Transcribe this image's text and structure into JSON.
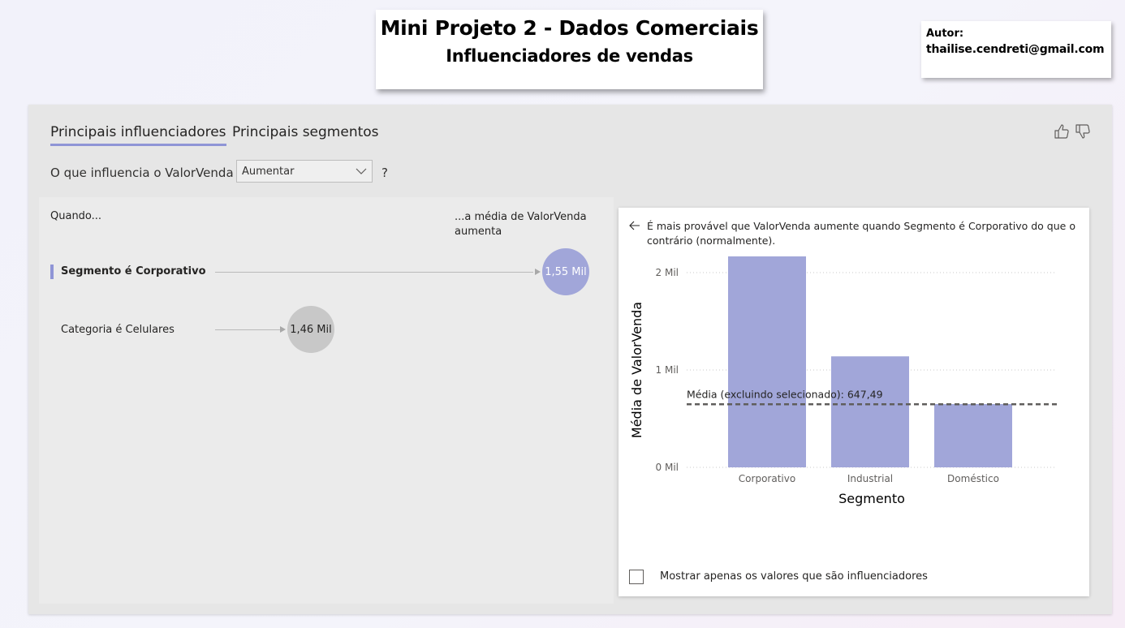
{
  "header": {
    "title": "Mini Projeto 2 - Dados Comerciais",
    "subtitle": "Influenciadores de vendas"
  },
  "author": {
    "label": "Autor:",
    "email": "thailise.cendreti@gmail.com"
  },
  "tabs": [
    {
      "label": "Principais influenciadores",
      "active": true
    },
    {
      "label": "Principais segmentos",
      "active": false
    }
  ],
  "feedback": {
    "like_icon": "thumbs-up-icon",
    "dislike_icon": "thumbs-down-icon"
  },
  "query": {
    "prefix": "O que influencia o ValorVenda a",
    "dropdown_value": "Aumentar",
    "help": "?"
  },
  "influencers": {
    "col_when": "Quando...",
    "col_avg": "...a média de ValorVenda aumenta",
    "rows": [
      {
        "label": "Segmento é Corporativo",
        "value_label": "1,55 Mil",
        "value": 1.55,
        "selected": true
      },
      {
        "label": "Categoria é Celulares",
        "value_label": "1,46 Mil",
        "value": 1.46,
        "selected": false
      }
    ]
  },
  "detail": {
    "back_icon": "back-arrow-icon",
    "description": "É mais provável que ValorVenda aumente quando Segmento é Corporativo do que o contrário (normalmente).",
    "checkbox_label": "Mostrar apenas os valores que são influenciadores",
    "checkbox_checked": false
  },
  "chart_data": {
    "type": "bar",
    "categories": [
      "Corporativo",
      "Industrial",
      "Doméstico"
    ],
    "values": [
      2.2,
      1.14,
      0.65
    ],
    "xlabel": "Segmento",
    "ylabel": "Média de ValorVenda",
    "ylim": [
      0,
      2
    ],
    "yticks": [
      0,
      1,
      2
    ],
    "ytick_labels": [
      "0 Mil",
      "1 Mil",
      "2 Mil"
    ],
    "reference_line": {
      "label": "Média (excluindo selecionado): 647,49",
      "value": 0.64749
    },
    "bar_color": "#a1a6d9",
    "grid": true
  },
  "colors": {
    "accent": "#8f95d6",
    "bubble_selected": "#a1a6d9",
    "bubble_other": "#c8c8c8"
  }
}
